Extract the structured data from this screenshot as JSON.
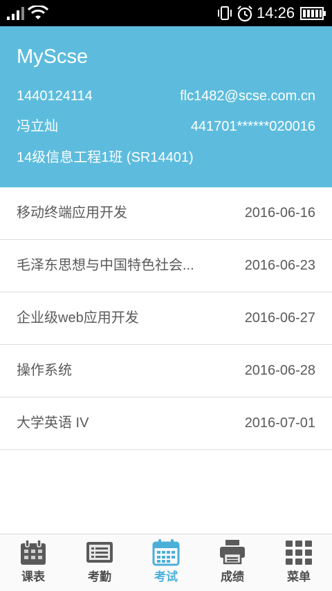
{
  "status_bar": {
    "time": "14:26"
  },
  "header": {
    "app_title": "MyScse",
    "student_id": "1440124114",
    "email": "flc1482@scse.com.cn",
    "name": "冯立灿",
    "id_number": "441701******020016",
    "class": "14级信息工程1班  (SR14401)"
  },
  "exams": [
    {
      "course": "移动终端应用开发",
      "date": "2016-06-16"
    },
    {
      "course": "毛泽东思想与中国特色社会...",
      "date": "2016-06-23"
    },
    {
      "course": "企业级web应用开发",
      "date": "2016-06-27"
    },
    {
      "course": "操作系统",
      "date": "2016-06-28"
    },
    {
      "course": "大学英语 IV",
      "date": "2016-07-01"
    }
  ],
  "tabs": [
    {
      "label": "课表",
      "icon": "calendar-schedule-icon"
    },
    {
      "label": "考勤",
      "icon": "attendance-list-icon"
    },
    {
      "label": "考试",
      "icon": "exam-calendar-icon"
    },
    {
      "label": "成绩",
      "icon": "grades-printer-icon"
    },
    {
      "label": "菜单",
      "icon": "menu-grid-icon"
    }
  ],
  "colors": {
    "header_bg": "#5dbcdd",
    "active_tab": "#4bb0d8",
    "inactive_tab": "#4d4d4d"
  }
}
